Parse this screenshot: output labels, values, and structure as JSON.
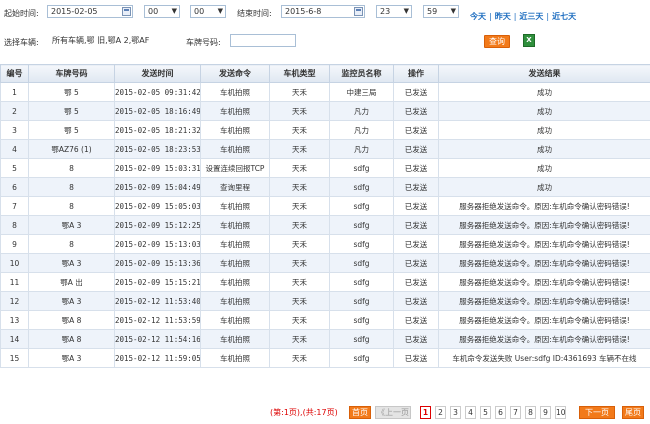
{
  "filters": {
    "start_label": "起始时间:",
    "start_date": "2015-02-05",
    "start_hour": "00",
    "start_min": "00",
    "end_label": "结束时间:",
    "end_date": "2015-6-8",
    "end_hour": "23",
    "end_min": "59",
    "quick": [
      "今天",
      "昨天",
      "近三天",
      "近七天"
    ],
    "vehicle_label": "选择车辆:",
    "vehicle_value": "所有车辆,鄂    旧,鄂A    2,鄂AF",
    "plate_label": "车牌号码:",
    "plate_value": "",
    "query_label": "查询",
    "excel_icon": "excel-icon"
  },
  "table": {
    "headers": [
      "编号",
      "车牌号码",
      "发送时间",
      "发送命令",
      "车机类型",
      "监控员名称",
      "操作",
      "发送结果"
    ],
    "rows": [
      {
        "no": "1",
        "plate": "鄂    5",
        "time": "2015-02-05 09:31:42",
        "cmd": "车机拍照",
        "type": "天禾",
        "user": "中建三局",
        "op": "已发送",
        "result": "成功"
      },
      {
        "no": "2",
        "plate": "鄂    5",
        "time": "2015-02-05 18:16:49",
        "cmd": "车机拍照",
        "type": "天禾",
        "user": "凡力",
        "op": "已发送",
        "result": "成功"
      },
      {
        "no": "3",
        "plate": "鄂    5",
        "time": "2015-02-05 18:21:32",
        "cmd": "车机拍照",
        "type": "天禾",
        "user": "凡力",
        "op": "已发送",
        "result": "成功"
      },
      {
        "no": "4",
        "plate": "鄂AZ76    (1)",
        "time": "2015-02-05 18:23:53",
        "cmd": "车机拍照",
        "type": "天禾",
        "user": "凡力",
        "op": "已发送",
        "result": "成功"
      },
      {
        "no": "5",
        "plate": "8",
        "time": "2015-02-09 15:03:31",
        "cmd": "设置连续回报TCP",
        "type": "天禾",
        "user": "sdfg",
        "op": "已发送",
        "result": "成功"
      },
      {
        "no": "6",
        "plate": "8",
        "time": "2015-02-09 15:04:49",
        "cmd": "查询里程",
        "type": "天禾",
        "user": "sdfg",
        "op": "已发送",
        "result": "成功"
      },
      {
        "no": "7",
        "plate": "8",
        "time": "2015-02-09 15:05:03",
        "cmd": "车机拍照",
        "type": "天禾",
        "user": "sdfg",
        "op": "已发送",
        "result": "服务器拒绝发送命令。原因:车机命令确认密码错误!"
      },
      {
        "no": "8",
        "plate": "鄂A    3",
        "time": "2015-02-09 15:12:25",
        "cmd": "车机拍照",
        "type": "天禾",
        "user": "sdfg",
        "op": "已发送",
        "result": "服务器拒绝发送命令。原因:车机命令确认密码错误!"
      },
      {
        "no": "9",
        "plate": "8",
        "time": "2015-02-09 15:13:03",
        "cmd": "车机拍照",
        "type": "天禾",
        "user": "sdfg",
        "op": "已发送",
        "result": "服务器拒绝发送命令。原因:车机命令确认密码错误!"
      },
      {
        "no": "10",
        "plate": "鄂A    3",
        "time": "2015-02-09 15:13:36",
        "cmd": "车机拍照",
        "type": "天禾",
        "user": "sdfg",
        "op": "已发送",
        "result": "服务器拒绝发送命令。原因:车机命令确认密码错误!"
      },
      {
        "no": "11",
        "plate": "鄂A        出",
        "time": "2015-02-09 15:15:21",
        "cmd": "车机拍照",
        "type": "天禾",
        "user": "sdfg",
        "op": "已发送",
        "result": "服务器拒绝发送命令。原因:车机命令确认密码错误!"
      },
      {
        "no": "12",
        "plate": "鄂A    3",
        "time": "2015-02-12 11:53:40",
        "cmd": "车机拍照",
        "type": "天禾",
        "user": "sdfg",
        "op": "已发送",
        "result": "服务器拒绝发送命令。原因:车机命令确认密码错误!"
      },
      {
        "no": "13",
        "plate": "鄂A    8",
        "time": "2015-02-12 11:53:59",
        "cmd": "车机拍照",
        "type": "天禾",
        "user": "sdfg",
        "op": "已发送",
        "result": "服务器拒绝发送命令。原因:车机命令确认密码错误!"
      },
      {
        "no": "14",
        "plate": "鄂A    8",
        "time": "2015-02-12 11:54:16",
        "cmd": "车机拍照",
        "type": "天禾",
        "user": "sdfg",
        "op": "已发送",
        "result": "服务器拒绝发送命令。原因:车机命令确认密码错误!"
      },
      {
        "no": "15",
        "plate": "鄂A    3",
        "time": "2015-02-12 11:59:05",
        "cmd": "车机拍照",
        "type": "天禾",
        "user": "sdfg",
        "op": "已发送",
        "result": "车机命令发送失败 User:sdfg ID:4361693 车辆不在线"
      }
    ]
  },
  "pager": {
    "summary": "(第:1页),(共:17页)",
    "first": "首页",
    "prev": "《上一页",
    "pages": [
      "1",
      "2",
      "3",
      "4",
      "5",
      "6",
      "7",
      "8",
      "9",
      "10"
    ],
    "current": "1",
    "next": "下一页",
    "last": "尾页"
  },
  "colors": {
    "accent": "#f27a1a",
    "link": "#1a6bbf",
    "ok": "#2e8b2e",
    "alert": "#dd0000"
  }
}
